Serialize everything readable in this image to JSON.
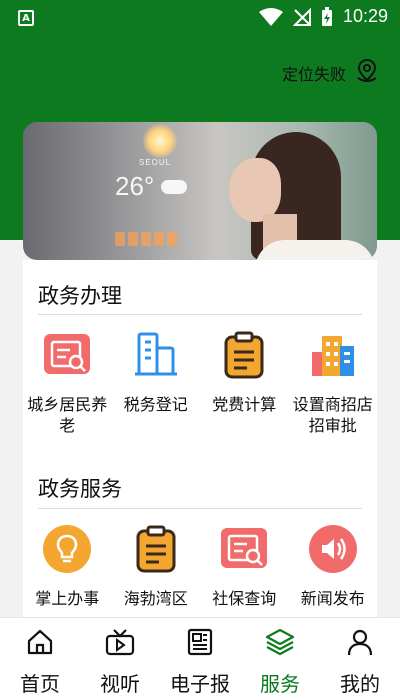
{
  "status_bar": {
    "sim_label": "A",
    "time": "10:29"
  },
  "location": {
    "label": "定位失败",
    "icon": "location-pin-icon"
  },
  "banner": {
    "weather_city": "SEOUL",
    "weather_temp": "26°"
  },
  "sections": [
    {
      "title": "政务办理",
      "items": [
        {
          "label": "城乡居民养老",
          "icon": "document-search-icon",
          "color": "#f26b6b"
        },
        {
          "label": "税务登记",
          "icon": "building-icon",
          "color": "#2f8fe8"
        },
        {
          "label": "党费计算",
          "icon": "clipboard-icon",
          "color": "#f3a630"
        },
        {
          "label": "设置商招店招审批",
          "icon": "city-buildings-icon",
          "color": "#f3a630"
        }
      ]
    },
    {
      "title": "政务服务",
      "items": [
        {
          "label": "掌上办事",
          "icon": "lightbulb-icon",
          "color": "#f3a630"
        },
        {
          "label": "海勃湾区",
          "icon": "clipboard-icon",
          "color": "#f3a630"
        },
        {
          "label": "社保查询",
          "icon": "document-search-icon",
          "color": "#f26b6b"
        },
        {
          "label": "新闻发布",
          "icon": "speaker-icon",
          "color": "#f26b6b"
        }
      ]
    }
  ],
  "bottom_nav": [
    {
      "label": "首页",
      "icon": "home-icon",
      "active": false
    },
    {
      "label": "视听",
      "icon": "video-icon",
      "active": false
    },
    {
      "label": "电子报",
      "icon": "newspaper-icon",
      "active": false
    },
    {
      "label": "服务",
      "icon": "layers-icon",
      "active": true
    },
    {
      "label": "我的",
      "icon": "person-icon",
      "active": false
    }
  ],
  "colors": {
    "brand_green": "#0e7a1f"
  }
}
